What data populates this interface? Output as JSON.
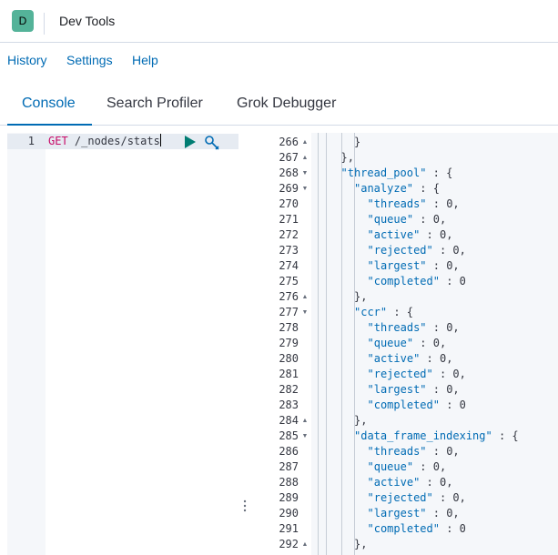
{
  "header": {
    "app_badge": "D",
    "title": "Dev Tools"
  },
  "top_links": [
    "History",
    "Settings",
    "Help"
  ],
  "tabs": [
    {
      "label": "Console",
      "selected": true
    },
    {
      "label": "Search Profiler",
      "selected": false
    },
    {
      "label": "Grok Debugger",
      "selected": false
    }
  ],
  "editor": {
    "line_number": "1",
    "method": "GET",
    "path": " /_nodes/stats",
    "run_icon": "play-icon",
    "settings_icon": "wrench-icon"
  },
  "output": {
    "lines": [
      {
        "num": "266",
        "fold": "up",
        "indent": 2,
        "key": "",
        "text": "}"
      },
      {
        "num": "267",
        "fold": "up",
        "indent": 1,
        "key": "",
        "text": "},"
      },
      {
        "num": "268",
        "fold": "down",
        "indent": 1,
        "key": "thread_pool",
        "text": " : {"
      },
      {
        "num": "269",
        "fold": "down",
        "indent": 2,
        "key": "analyze",
        "text": " : {"
      },
      {
        "num": "270",
        "fold": "",
        "indent": 3,
        "key": "threads",
        "text": " : 0,"
      },
      {
        "num": "271",
        "fold": "",
        "indent": 3,
        "key": "queue",
        "text": " : 0,"
      },
      {
        "num": "272",
        "fold": "",
        "indent": 3,
        "key": "active",
        "text": " : 0,"
      },
      {
        "num": "273",
        "fold": "",
        "indent": 3,
        "key": "rejected",
        "text": " : 0,"
      },
      {
        "num": "274",
        "fold": "",
        "indent": 3,
        "key": "largest",
        "text": " : 0,"
      },
      {
        "num": "275",
        "fold": "",
        "indent": 3,
        "key": "completed",
        "text": " : 0"
      },
      {
        "num": "276",
        "fold": "up",
        "indent": 2,
        "key": "",
        "text": "},"
      },
      {
        "num": "277",
        "fold": "down",
        "indent": 2,
        "key": "ccr",
        "text": " : {"
      },
      {
        "num": "278",
        "fold": "",
        "indent": 3,
        "key": "threads",
        "text": " : 0,"
      },
      {
        "num": "279",
        "fold": "",
        "indent": 3,
        "key": "queue",
        "text": " : 0,"
      },
      {
        "num": "280",
        "fold": "",
        "indent": 3,
        "key": "active",
        "text": " : 0,"
      },
      {
        "num": "281",
        "fold": "",
        "indent": 3,
        "key": "rejected",
        "text": " : 0,"
      },
      {
        "num": "282",
        "fold": "",
        "indent": 3,
        "key": "largest",
        "text": " : 0,"
      },
      {
        "num": "283",
        "fold": "",
        "indent": 3,
        "key": "completed",
        "text": " : 0"
      },
      {
        "num": "284",
        "fold": "up",
        "indent": 2,
        "key": "",
        "text": "},"
      },
      {
        "num": "285",
        "fold": "down",
        "indent": 2,
        "key": "data_frame_indexing",
        "text": " : {"
      },
      {
        "num": "286",
        "fold": "",
        "indent": 3,
        "key": "threads",
        "text": " : 0,"
      },
      {
        "num": "287",
        "fold": "",
        "indent": 3,
        "key": "queue",
        "text": " : 0,"
      },
      {
        "num": "288",
        "fold": "",
        "indent": 3,
        "key": "active",
        "text": " : 0,"
      },
      {
        "num": "289",
        "fold": "",
        "indent": 3,
        "key": "rejected",
        "text": " : 0,"
      },
      {
        "num": "290",
        "fold": "",
        "indent": 3,
        "key": "largest",
        "text": " : 0,"
      },
      {
        "num": "291",
        "fold": "",
        "indent": 3,
        "key": "completed",
        "text": " : 0"
      },
      {
        "num": "292",
        "fold": "up",
        "indent": 2,
        "key": "",
        "text": "},"
      }
    ]
  },
  "colors": {
    "accent": "#006bb4",
    "badge": "#54b399",
    "method": "#c80a68",
    "run": "#017d73"
  }
}
